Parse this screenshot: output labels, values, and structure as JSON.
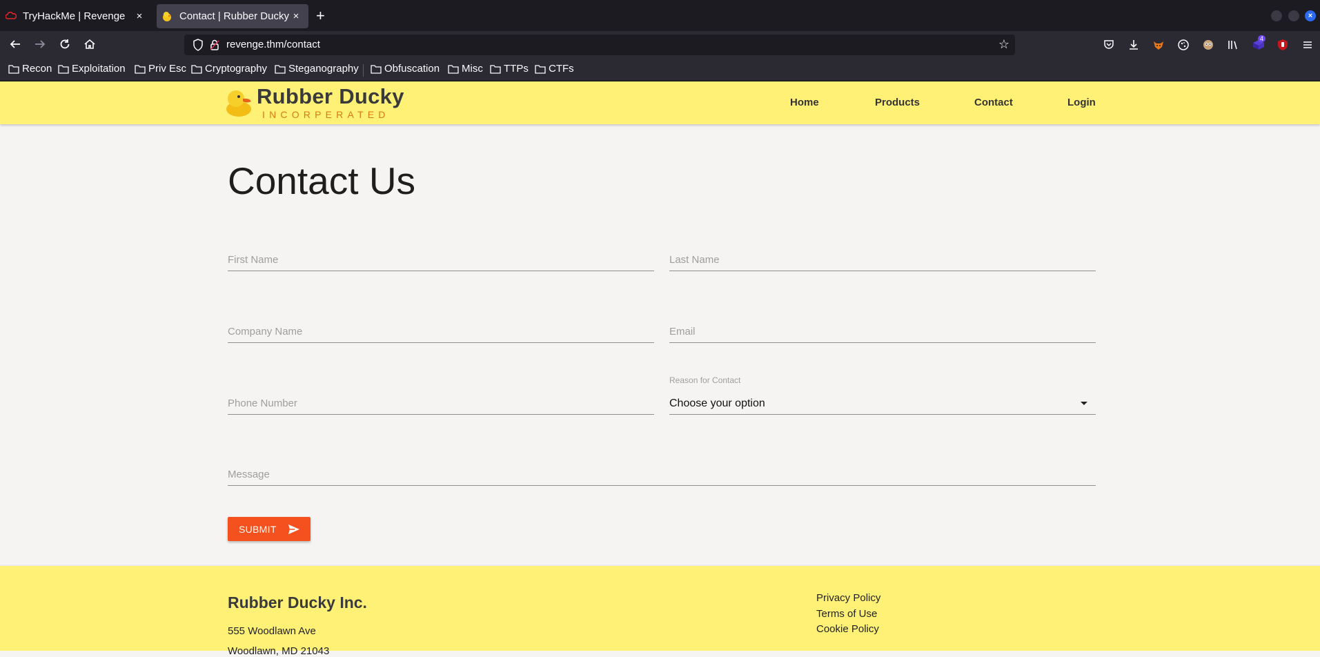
{
  "browser": {
    "tabs": [
      {
        "title": "TryHackMe | Revenge",
        "active": false
      },
      {
        "title": "Contact | Rubber Ducky Inc",
        "active": true
      }
    ],
    "new_tab_symbol": "+",
    "close_symbol": "×",
    "url": "revenge.thm/contact",
    "bookmarks": [
      "Recon",
      "Exploitation",
      "Priv Esc",
      "Cryptography",
      "Steganography",
      "Obfuscation",
      "Misc",
      "TTPs",
      "CTFs"
    ],
    "extension_badge": "4"
  },
  "site": {
    "brand": "Rubber Ducky",
    "tagline": "INCORPERATED",
    "nav": [
      "Home",
      "Products",
      "Contact",
      "Login"
    ]
  },
  "form": {
    "title": "Contact Us",
    "first_name_placeholder": "First Name",
    "last_name_placeholder": "Last Name",
    "company_placeholder": "Company Name",
    "email_placeholder": "Email",
    "phone_placeholder": "Phone Number",
    "reason_label": "Reason for Contact",
    "reason_value": "Choose your option",
    "message_placeholder": "Message",
    "submit_label": "SUBMIT"
  },
  "footer": {
    "company": "Rubber Ducky Inc.",
    "address_line1": "555 Woodlawn Ave",
    "address_line2": "Woodlawn, MD 21043",
    "links": [
      "Privacy Policy",
      "Terms of Use",
      "Cookie Policy"
    ]
  },
  "colors": {
    "header_bg": "#fff176",
    "submit_bg": "#f4511e",
    "tagline": "#d97a10",
    "page_bg": "#f5f4f3"
  }
}
